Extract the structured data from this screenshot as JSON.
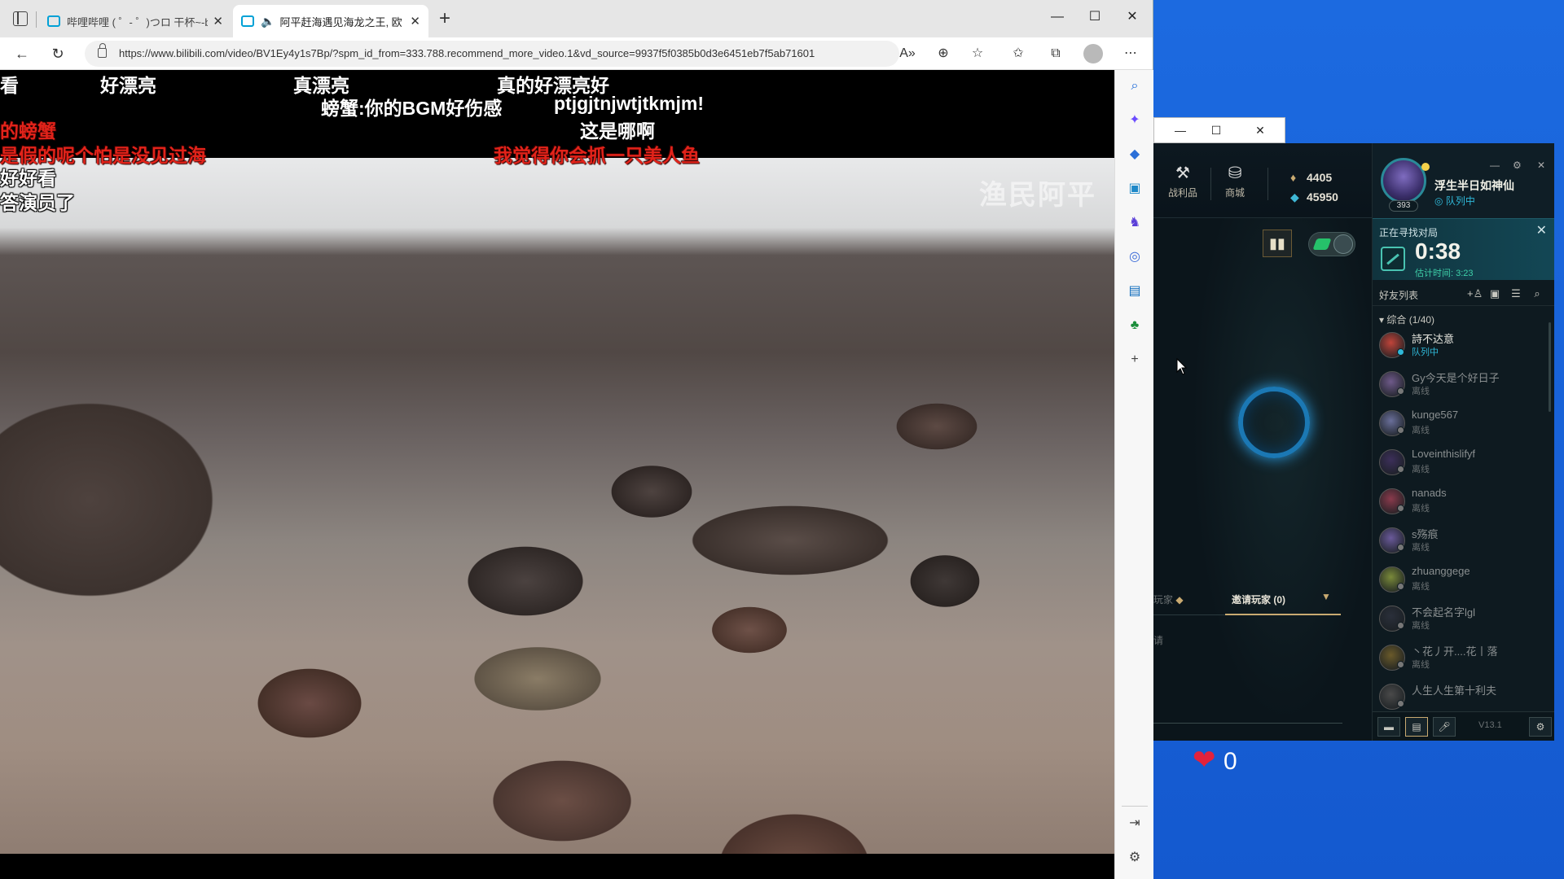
{
  "browser": {
    "tabs": [
      {
        "label": "哔哩哔哩 ( ゜- ゜)つロ 干杯~-bilibili",
        "active": false
      },
      {
        "label": "阿平赶海遇见海龙之王, 欧",
        "active": true
      }
    ],
    "url": "https://www.bilibili.com/video/BV1Ey4y1s7Bp/?spm_id_from=333.788.recommend_more_video.1&vd_source=9937f5f0385b0d3e6451eb7f5ab71601"
  },
  "video": {
    "watermark": "渔民阿平",
    "danmaku": [
      {
        "text": "看",
        "color": "white"
      },
      {
        "text": "好漂亮",
        "color": "white"
      },
      {
        "text": "真漂亮",
        "color": "white"
      },
      {
        "text": "真的好漂亮好",
        "color": "white"
      },
      {
        "text": "螃蟹:你的BGM好伤感",
        "color": "white"
      },
      {
        "text": "ptjgjtnjwtjtkmjm!",
        "color": "white"
      },
      {
        "text": "的螃蟹",
        "color": "red"
      },
      {
        "text": "这是哪啊",
        "color": "white"
      },
      {
        "text": "是假的呢个怕是没见过海",
        "color": "red"
      },
      {
        "text": "我觉得你会抓一只美人鱼",
        "color": "red"
      },
      {
        "text": "好好看",
        "color": "white"
      },
      {
        "text": "答演员了",
        "color": "white"
      }
    ]
  },
  "game": {
    "top": {
      "loot_label": "战利品",
      "store_label": "商城",
      "rp": "4405",
      "be": "45950"
    },
    "profile": {
      "name": "浮生半日如神仙",
      "status": "队列中",
      "level": "393"
    },
    "queue": {
      "title": "正在寻找对局",
      "timer": "0:38",
      "estimate": "估计时间: 3:23"
    },
    "invite": {
      "left_label": "玩家",
      "tab_label": "邀请玩家 (0)",
      "cut_label": "请"
    },
    "friends": {
      "title": "好友列表",
      "group": "综合 (1/40)",
      "list": [
        {
          "name": "詩不达意",
          "status": "队列中",
          "online": true,
          "color": "#c0443a"
        },
        {
          "name": "Gy今天是个好日子",
          "status": "离线",
          "online": false,
          "color": "#6f5a8a"
        },
        {
          "name": "kunge567",
          "status": "离线",
          "online": false,
          "color": "#6a6f9a"
        },
        {
          "name": "Loveinthislifyf",
          "status": "离线",
          "online": false,
          "color": "#3c2f5a"
        },
        {
          "name": "nanads",
          "status": "离线",
          "online": false,
          "color": "#8a3a4c"
        },
        {
          "name": "s殇痕",
          "status": "离线",
          "online": false,
          "color": "#6a5a9a"
        },
        {
          "name": "zhuanggege",
          "status": "离线",
          "online": false,
          "color": "#7a8a3a"
        },
        {
          "name": "不会起名字lgl",
          "status": "离线",
          "online": false,
          "color": "#2a2f3a"
        },
        {
          "name": "丶花丿开....花丨落",
          "status": "离线",
          "online": false,
          "color": "#6a5a2a"
        },
        {
          "name": "人生人生第十利夫",
          "status": "",
          "online": false,
          "color": "#4a4a4a"
        }
      ]
    },
    "version": "V13.1"
  },
  "overlay": {
    "heart_count": "0"
  }
}
